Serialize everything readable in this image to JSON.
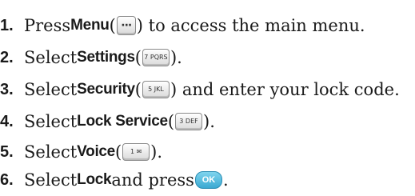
{
  "steps": [
    {
      "number": "1.",
      "pre": "Press ",
      "keyword": "Menu",
      "mid": " (",
      "key": "···",
      "post": ") to access the main menu."
    },
    {
      "number": "2.",
      "pre": "Select ",
      "keyword": "Settings",
      "mid": " (",
      "key": "7 PQRS",
      "post": ")."
    },
    {
      "number": "3.",
      "pre": "Select ",
      "keyword": "Security",
      "mid": " (",
      "key": "5 JKL",
      "post": ") and enter your lock code."
    },
    {
      "number": "4.",
      "pre": "Select ",
      "keyword": "Lock Service",
      "mid": " (",
      "key": "3 DEF",
      "post": ")."
    },
    {
      "number": "5.",
      "pre": "Select ",
      "keyword": "Voice",
      "mid": " (",
      "key": "1 ✉",
      "post": ")."
    },
    {
      "number": "6.",
      "pre": "Select ",
      "keyword": "Lock",
      "mid": " and press ",
      "key": "OK",
      "post": "."
    }
  ],
  "icons": {
    "menu_key": "menu-key-icon",
    "ok_key": "ok-key-icon",
    "ok_color": "#3aa9d2"
  }
}
